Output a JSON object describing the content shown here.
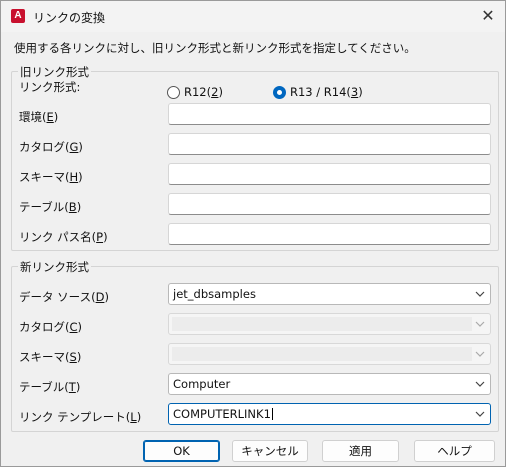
{
  "window": {
    "title": "リンクの変換",
    "app_icon_letter": "A"
  },
  "instruction": "使用する各リンクに対し、旧リンク形式と新リンク形式を指定してください。",
  "old_group": {
    "title": "旧リンク形式",
    "format_label": "リンク形式:",
    "radio_r12": "R12(2)",
    "radio_r13": "R13 / R14(3)",
    "selected": "r13",
    "env_label": "環境(E)",
    "catalog_label": "カタログ(G)",
    "schema_label": "スキーマ(H)",
    "table_label": "テーブル(B)",
    "path_label": "リンク パス名(P)",
    "env_value": "",
    "catalog_value": "",
    "schema_value": "",
    "table_value": "",
    "path_value": ""
  },
  "new_group": {
    "title": "新リンク形式",
    "datasource_label": "データ ソース(D)",
    "catalog_label": "カタログ(C)",
    "schema_label": "スキーマ(S)",
    "table_label": "テーブル(T)",
    "template_label": "リンク テンプレート(L)",
    "datasource_value": "jet_dbsamples",
    "catalog_value": "",
    "schema_value": "",
    "table_value": "Computer",
    "template_value": "COMPUTERLINK1"
  },
  "buttons": {
    "ok": "OK",
    "cancel": "キャンセル",
    "apply": "適用",
    "help": "ヘルプ"
  },
  "colors": {
    "accent": "#0067c0",
    "app_icon": "#c8102e"
  }
}
